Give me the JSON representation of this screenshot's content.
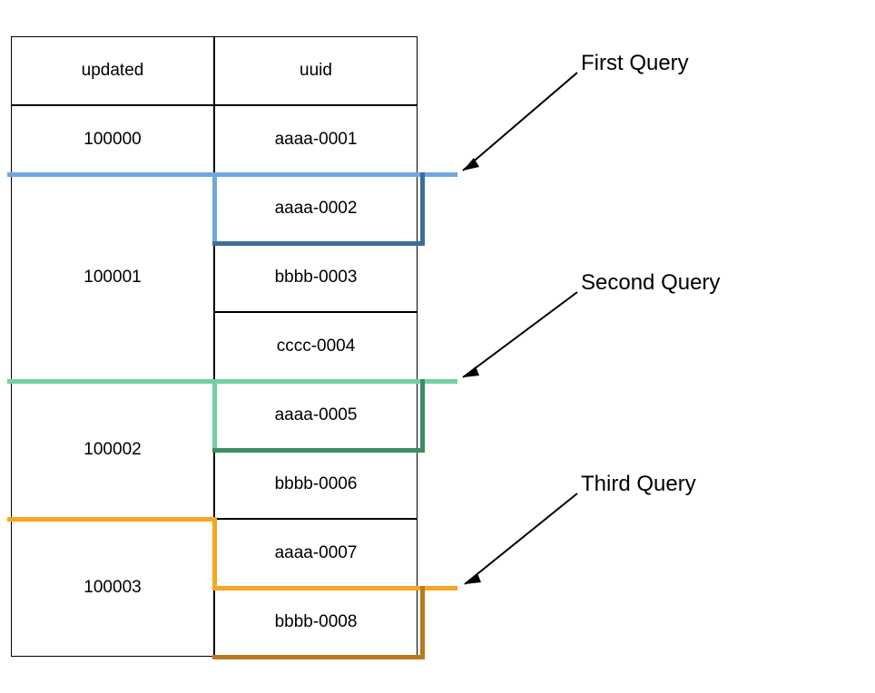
{
  "table": {
    "headers": {
      "updated": "updated",
      "uuid": "uuid"
    },
    "rows": [
      {
        "updated": "100000",
        "uuids": [
          "aaaa-0001"
        ]
      },
      {
        "updated": "100001",
        "uuids": [
          "aaaa-0002",
          "bbbb-0003",
          "cccc-0004"
        ]
      },
      {
        "updated": "100002",
        "uuids": [
          "aaaa-0005",
          "bbbb-0006"
        ]
      },
      {
        "updated": "100003",
        "uuids": [
          "aaaa-0007",
          "bbbb-0008"
        ]
      }
    ]
  },
  "queries": {
    "first": {
      "label": "First Query",
      "color": "#6FA8DC",
      "dark": "#3D6E9C"
    },
    "second": {
      "label": "Second Query",
      "color": "#72D0A2",
      "dark": "#3D8B63"
    },
    "third": {
      "label": "Third Query",
      "color": "#F5A623",
      "dark": "#B97A1A"
    }
  }
}
